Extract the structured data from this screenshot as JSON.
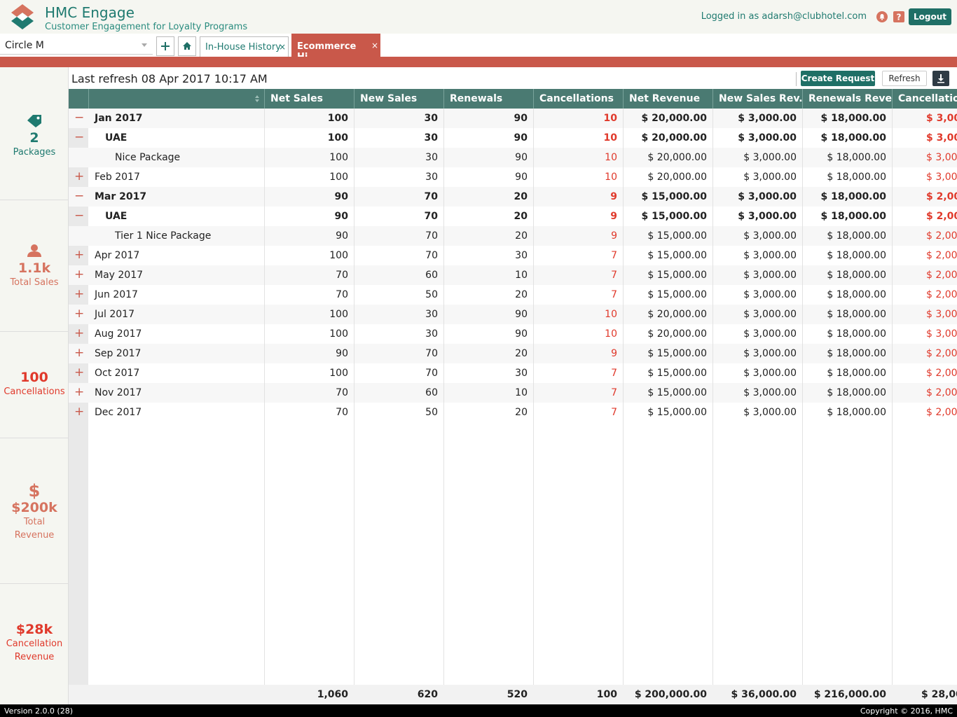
{
  "header": {
    "title": "HMC Engage",
    "subtitle": "Customer Engagement for Loyalty Programs",
    "logged_in": "Logged in as adarsh@clubhotel.com",
    "logout": "Logout"
  },
  "selector": {
    "value": "Circle M"
  },
  "tabs": [
    {
      "label": "In-House History",
      "active": false
    },
    {
      "label": "Ecommerce Hi...",
      "active": true
    }
  ],
  "toolbar": {
    "last_refresh": "Last refresh 08 Apr 2017 10:17 AM",
    "create_request": "Create Request",
    "refresh": "Refresh"
  },
  "sidebar": {
    "packages": {
      "value": "2",
      "label": "Packages",
      "color": "#1f7a70"
    },
    "total_sales": {
      "value": "1.1k",
      "label": "Total Sales",
      "color": "#d6735f"
    },
    "cancellations": {
      "value": "100",
      "label": "Cancellations",
      "color": "#e0392b"
    },
    "total_revenue": {
      "value": "$200k",
      "label1": "Total",
      "label2": "Revenue",
      "color": "#d6735f"
    },
    "cancellation_revenue": {
      "value": "$28k",
      "label1": "Cancellation",
      "label2": "Revenue",
      "color": "#e0392b"
    }
  },
  "grid": {
    "columns": [
      "Net Sales",
      "New Sales",
      "Renewals",
      "Cancellations",
      "Net Revenue",
      "New Sales Rev...",
      "Renewals Reve...",
      "Cancellation"
    ],
    "rows": [
      {
        "toggle": "−",
        "level": 0,
        "bold": true,
        "name": "Jan 2017",
        "cells": [
          "100",
          "30",
          "90",
          "10",
          "$ 20,000.00",
          "$ 3,000.00",
          "$ 18,000.00",
          "$ 3,00"
        ]
      },
      {
        "toggle": "−",
        "level": 1,
        "bold": true,
        "name": "UAE",
        "cells": [
          "100",
          "30",
          "90",
          "10",
          "$ 20,000.00",
          "$ 3,000.00",
          "$ 18,000.00",
          "$ 3,00"
        ]
      },
      {
        "toggle": "",
        "level": 2,
        "bold": false,
        "name": "Nice Package",
        "cells": [
          "100",
          "30",
          "90",
          "10",
          "$ 20,000.00",
          "$ 3,000.00",
          "$ 18,000.00",
          "$ 3,00"
        ]
      },
      {
        "toggle": "+",
        "level": 0,
        "bold": false,
        "name": "Feb 2017",
        "cells": [
          "100",
          "30",
          "90",
          "10",
          "$ 20,000.00",
          "$ 3,000.00",
          "$ 18,000.00",
          "$ 3,00"
        ]
      },
      {
        "toggle": "−",
        "level": 0,
        "bold": true,
        "name": "Mar 2017",
        "cells": [
          "90",
          "70",
          "20",
          "9",
          "$ 15,000.00",
          "$ 3,000.00",
          "$ 18,000.00",
          "$ 2,00"
        ]
      },
      {
        "toggle": "−",
        "level": 1,
        "bold": true,
        "name": "UAE",
        "cells": [
          "90",
          "70",
          "20",
          "9",
          "$ 15,000.00",
          "$ 3,000.00",
          "$ 18,000.00",
          "$ 2,00"
        ]
      },
      {
        "toggle": "",
        "level": 2,
        "bold": false,
        "name": "Tier 1 Nice Package",
        "cells": [
          "90",
          "70",
          "20",
          "9",
          "$ 15,000.00",
          "$ 3,000.00",
          "$ 18,000.00",
          "$ 2,00"
        ]
      },
      {
        "toggle": "+",
        "level": 0,
        "bold": false,
        "name": "Apr 2017",
        "cells": [
          "100",
          "70",
          "30",
          "7",
          "$ 15,000.00",
          "$ 3,000.00",
          "$ 18,000.00",
          "$ 2,00"
        ]
      },
      {
        "toggle": "+",
        "level": 0,
        "bold": false,
        "name": "May 2017",
        "cells": [
          "70",
          "60",
          "10",
          "7",
          "$ 15,000.00",
          "$ 3,000.00",
          "$ 18,000.00",
          "$ 2,00"
        ]
      },
      {
        "toggle": "+",
        "level": 0,
        "bold": false,
        "name": "Jun 2017",
        "cells": [
          "70",
          "50",
          "20",
          "7",
          "$ 15,000.00",
          "$ 3,000.00",
          "$ 18,000.00",
          "$ 2,00"
        ]
      },
      {
        "toggle": "+",
        "level": 0,
        "bold": false,
        "name": "Jul 2017",
        "cells": [
          "100",
          "30",
          "90",
          "10",
          "$ 20,000.00",
          "$ 3,000.00",
          "$ 18,000.00",
          "$ 3,00"
        ]
      },
      {
        "toggle": "+",
        "level": 0,
        "bold": false,
        "name": "Aug 2017",
        "cells": [
          "100",
          "30",
          "90",
          "10",
          "$ 20,000.00",
          "$ 3,000.00",
          "$ 18,000.00",
          "$ 3,00"
        ]
      },
      {
        "toggle": "+",
        "level": 0,
        "bold": false,
        "name": "Sep 2017",
        "cells": [
          "90",
          "70",
          "20",
          "9",
          "$ 15,000.00",
          "$ 3,000.00",
          "$ 18,000.00",
          "$ 2,00"
        ]
      },
      {
        "toggle": "+",
        "level": 0,
        "bold": false,
        "name": "Oct 2017",
        "cells": [
          "100",
          "70",
          "30",
          "7",
          "$ 15,000.00",
          "$ 3,000.00",
          "$ 18,000.00",
          "$ 2,00"
        ]
      },
      {
        "toggle": "+",
        "level": 0,
        "bold": false,
        "name": "Nov 2017",
        "cells": [
          "70",
          "60",
          "10",
          "7",
          "$ 15,000.00",
          "$ 3,000.00",
          "$ 18,000.00",
          "$ 2,00"
        ]
      },
      {
        "toggle": "+",
        "level": 0,
        "bold": false,
        "name": "Dec 2017",
        "cells": [
          "70",
          "50",
          "20",
          "7",
          "$ 15,000.00",
          "$ 3,000.00",
          "$ 18,000.00",
          "$ 2,00"
        ]
      }
    ],
    "totals": [
      "1,060",
      "620",
      "520",
      "100",
      "$ 200,000.00",
      "$ 36,000.00",
      "$ 216,000.00",
      "$ 28,00"
    ]
  },
  "footer": {
    "version": "Version 2.0.0 (28)",
    "copyright": "Copyright © 2016, HMC"
  }
}
